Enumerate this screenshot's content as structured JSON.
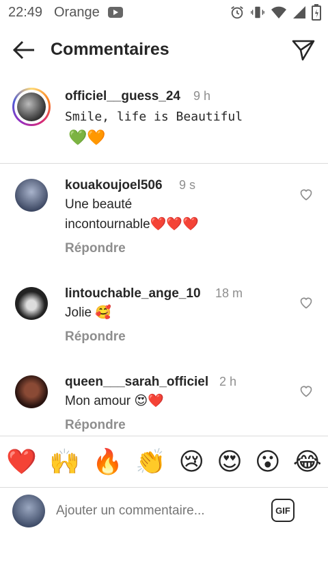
{
  "status_bar": {
    "time": "22:49",
    "carrier": "Orange"
  },
  "header": {
    "title": "Commentaires"
  },
  "caption": {
    "username": "officiel__guess_24",
    "time": "9 h",
    "text": "Smile, life is Beautiful",
    "emojis": "💚🧡"
  },
  "comments": [
    {
      "username": "kouakoujoel506",
      "time": "9 s",
      "line1": "Une beauté",
      "line2": "incontournable❤️❤️❤️",
      "reply": "Répondre"
    },
    {
      "username": "lintouchable_ange_10",
      "time": "18 m",
      "line1": "Jolie 🥰",
      "reply": "Répondre"
    },
    {
      "username": "queen___sarah_officiel",
      "time": "2 h",
      "line1": "Mon amour 😍❤️",
      "reply": "Répondre"
    }
  ],
  "reactions": [
    "❤️",
    "🙌",
    "🔥",
    "👏",
    "😢",
    "😍",
    "😮",
    "😂"
  ],
  "composer": {
    "placeholder": "Ajouter un commentaire...",
    "gif_label": "GIF"
  },
  "colors": {
    "text": "#262626",
    "muted": "#8e8e8e",
    "divider": "#dbdbdb"
  }
}
